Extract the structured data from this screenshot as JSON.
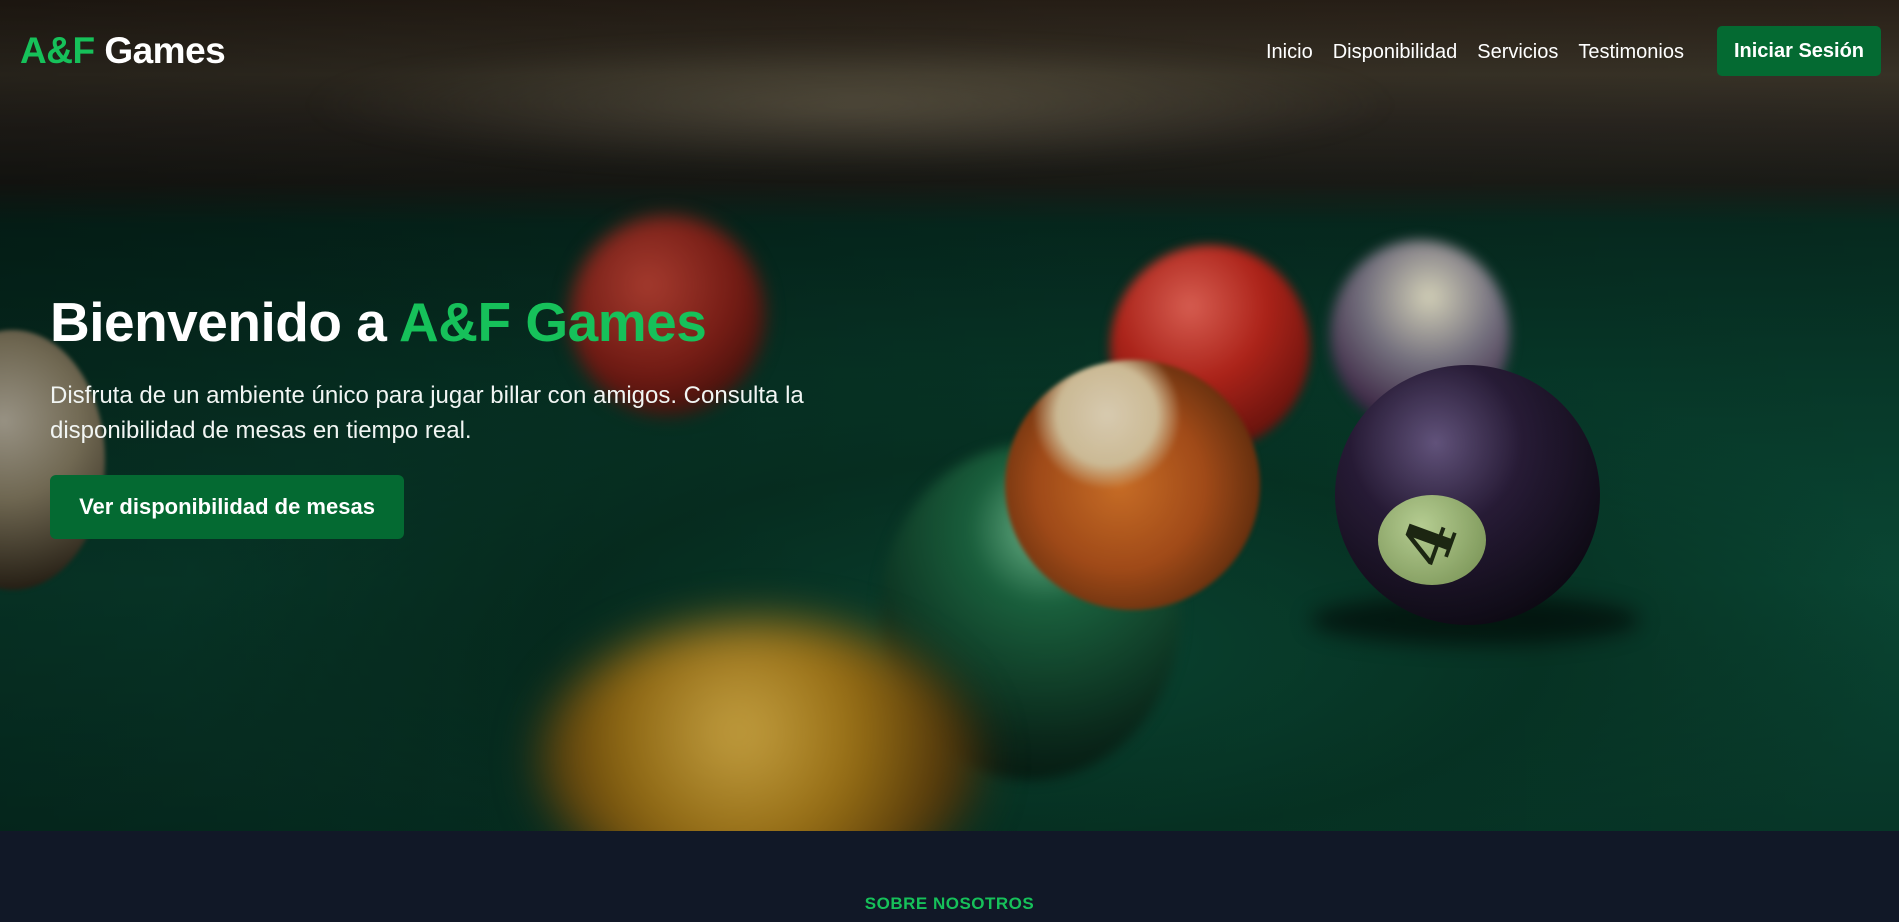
{
  "brand": {
    "accent": "A&F",
    "rest": " Games"
  },
  "nav": {
    "links": [
      "Inicio",
      "Disponibilidad",
      "Servicios",
      "Testimonios"
    ],
    "login_label": "Iniciar Sesión"
  },
  "hero": {
    "title_prefix": "Bienvenido a ",
    "title_accent": "A&F Games",
    "subtitle": "Disfruta de un ambiente único para jugar billar con amigos. Consulta la disponibilidad de mesas en tiempo real.",
    "cta_label": "Ver disponibilidad de mesas",
    "ball_number": "4"
  },
  "about": {
    "label": "SOBRE NOSOTROS"
  },
  "colors": {
    "accent": "#16c15a",
    "button": "#046a32",
    "dark_bg": "#111827"
  }
}
